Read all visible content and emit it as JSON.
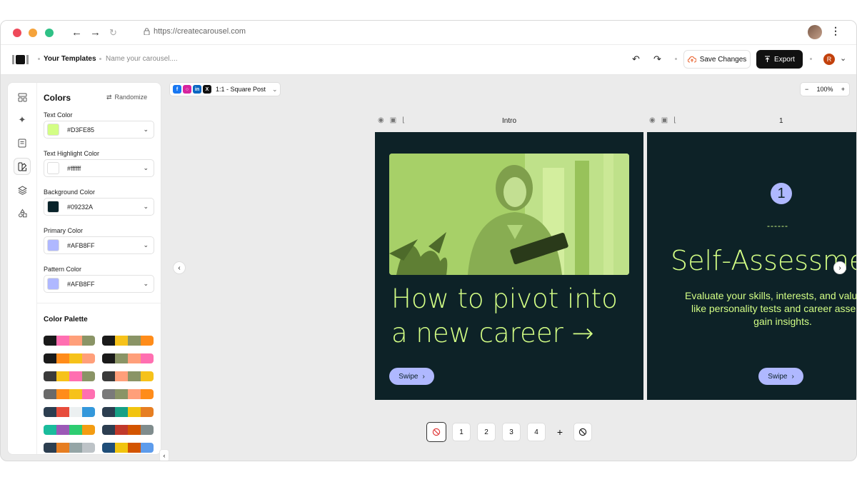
{
  "browser": {
    "url": "https://createcarousel.com",
    "dots": [
      "#ee4a5a",
      "#f5a33b",
      "#2fc186"
    ]
  },
  "header": {
    "templates_label": "Your Templates",
    "carousel_name_placeholder": "Name your carousel....",
    "save_label": "Save Changes",
    "export_label": "Export",
    "user_initial": "R"
  },
  "sidebar": {
    "title": "Colors",
    "randomize_label": "Randomize",
    "fields": [
      {
        "label": "Text Color",
        "value": "#D3FE85",
        "swatch": "#D3FE85"
      },
      {
        "label": "Text Highlight Color",
        "value": "#ffffff",
        "swatch": "#ffffff"
      },
      {
        "label": "Background Color",
        "value": "#09232A",
        "swatch": "#09232A"
      },
      {
        "label": "Primary Color",
        "value": "#AFB8FF",
        "swatch": "#AFB8FF"
      },
      {
        "label": "Pattern Color",
        "value": "#AFB8FF",
        "swatch": "#AFB8FF"
      }
    ],
    "palette_title": "Color Palette",
    "palettes": [
      [
        "#1a1a1a",
        "#ff6fb1",
        "#ff9f7a",
        "#8a9466"
      ],
      [
        "#1a1a1a",
        "#f6c21a",
        "#8a9466",
        "#ff8c1a"
      ],
      [
        "#1a1a1a",
        "#ff8c1a",
        "#f6c21a",
        "#ff9f7a"
      ],
      [
        "#1a1a1a",
        "#8a9466",
        "#ff9f7a",
        "#ff6fb1"
      ],
      [
        "#3a3a3a",
        "#f6c21a",
        "#ff6fb1",
        "#8a9466"
      ],
      [
        "#3a3a3a",
        "#ff9f7a",
        "#8a9466",
        "#f6c21a"
      ],
      [
        "#6a6a6a",
        "#ff8c1a",
        "#f6c21a",
        "#ff6fb1"
      ],
      [
        "#7a7a7a",
        "#8a9466",
        "#ff9f7a",
        "#ff8c1a"
      ],
      [
        "#2c3e50",
        "#e74c3c",
        "#ecf0f1",
        "#3498db"
      ],
      [
        "#2c3e50",
        "#16a085",
        "#f1c40f",
        "#e67e22"
      ],
      [
        "#1abc9c",
        "#9b59b6",
        "#2ecc71",
        "#f39c12"
      ],
      [
        "#2c3e50",
        "#c0392b",
        "#d35400",
        "#7f8c8d"
      ],
      [
        "#2c3e50",
        "#e67e22",
        "#95a5a6",
        "#bdc3c7"
      ],
      [
        "#1f4e79",
        "#f1c40f",
        "#d35400",
        "#5d9cec"
      ]
    ]
  },
  "canvas": {
    "format_label": "1:1 - Square Post",
    "zoom": "100%",
    "slides": [
      {
        "name": "Intro",
        "headline_lines": [
          "How to pivot into",
          "a new career →"
        ],
        "swipe": "Swipe"
      },
      {
        "name": "1",
        "number": "1",
        "dashes": "------",
        "title": "Self-Assessme",
        "body_lines": [
          "Evaluate your skills, interests, and values. U",
          "like personality tests and career assessm",
          "gain insights."
        ],
        "swipe": "Swipe"
      }
    ],
    "pages": [
      "1",
      "2",
      "3",
      "4"
    ],
    "add_label": "+"
  },
  "colors": {
    "text": "#D3FE85",
    "background": "#09232A",
    "primary": "#AFB8FF"
  }
}
